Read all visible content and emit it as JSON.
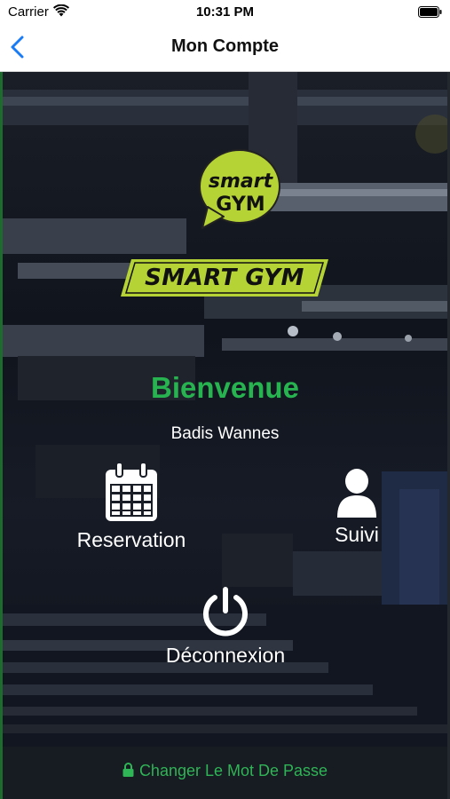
{
  "status_bar": {
    "carrier": "Carrier",
    "time": "10:31 PM"
  },
  "nav": {
    "title": "Mon Compte",
    "back_icon": "chevron-left-icon"
  },
  "logo": {
    "bubble_line1": "smart",
    "bubble_line2": "GYM",
    "banner_text": "SMART GYM",
    "brand_color": "#b5d334"
  },
  "welcome": {
    "title": "Bienvenue",
    "user_name": "Badis Wannes",
    "title_color": "#27b34f"
  },
  "actions": [
    {
      "label": "Reservation",
      "icon": "calendar-icon"
    },
    {
      "label": "Suivi",
      "icon": "user-icon"
    },
    {
      "label": "Déconnexion",
      "icon": "power-icon"
    }
  ],
  "footer": {
    "change_password": "Changer Le Mot De Passe",
    "icon": "lock-icon",
    "color": "#2fb456"
  }
}
